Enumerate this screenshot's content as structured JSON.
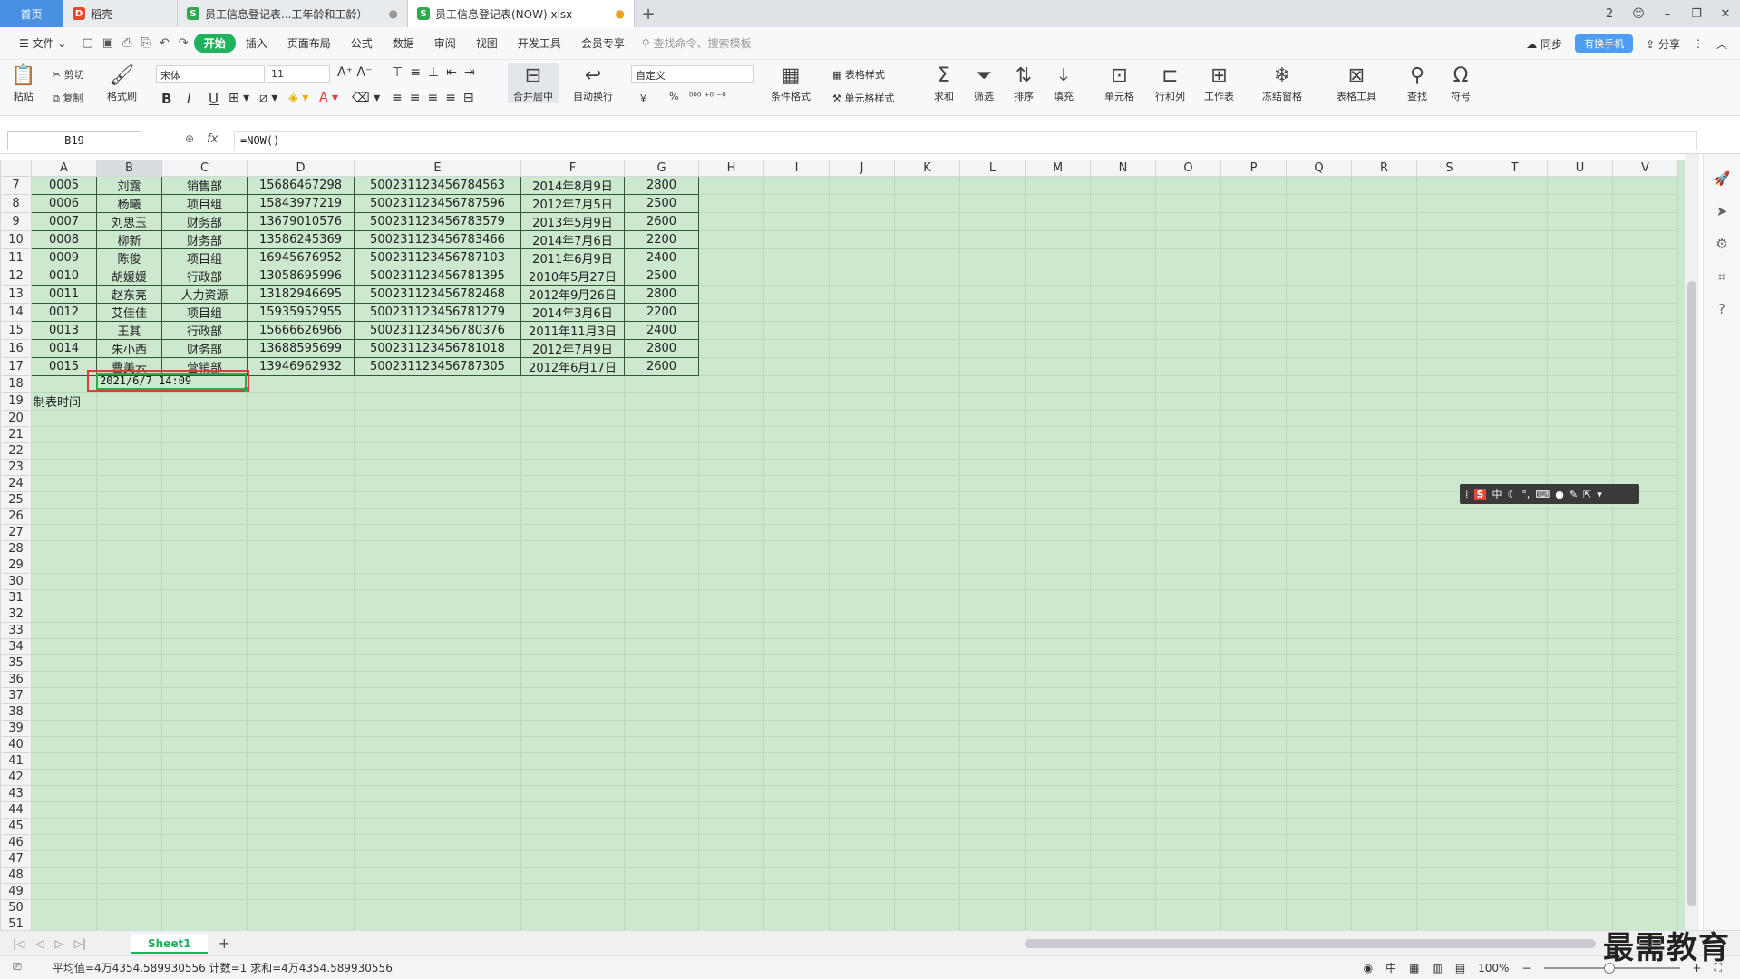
{
  "tabs": [
    {
      "label": "首页"
    },
    {
      "label": "稻壳"
    },
    {
      "label": "员工信息登记表...工年龄和工龄）"
    },
    {
      "label": "员工信息登记表(NOW).xlsx"
    }
  ],
  "window_badge": "2",
  "menu": {
    "file": "文件",
    "items": [
      "开始",
      "插入",
      "页面布局",
      "公式",
      "数据",
      "审阅",
      "视图",
      "开发工具",
      "会员专享"
    ],
    "search_placeholder": "查找命令、搜索模板",
    "sync": "同步",
    "promo": "有换手机",
    "share": "分享"
  },
  "ribbon": {
    "paste": "粘贴",
    "cut": "剪切",
    "copy": "复制",
    "format_painter": "格式刷",
    "font_name": "宋体",
    "font_size": "11",
    "merge_center": "合并居中",
    "wrap": "自动换行",
    "number_format": "自定义",
    "table_style": "表格样式",
    "cond_format": "条件格式",
    "cell_style": "单元格样式",
    "sum": "求和",
    "filter": "筛选",
    "sort": "排序",
    "fill": "填充",
    "cell": "单元格",
    "row_col": "行和列",
    "worksheet": "工作表",
    "freeze": "冻结窗格",
    "table_tools": "表格工具",
    "find": "查找",
    "symbol": "符号",
    "bold": "B",
    "italic": "I",
    "underline": "U",
    "currency": "￥",
    "percent": "%"
  },
  "formula_bar": {
    "name_box": "B19",
    "fx": "fx",
    "formula": "=NOW()"
  },
  "columns": [
    "A",
    "B",
    "C",
    "D",
    "E",
    "F",
    "G",
    "H",
    "I",
    "J",
    "K",
    "L",
    "M",
    "N",
    "O",
    "P",
    "Q",
    "R",
    "S",
    "T",
    "U",
    "V"
  ],
  "rows": [
    {
      "n": "7",
      "cells": [
        "0005",
        "刘露",
        "销售部",
        "15686467298",
        "500231123456784563",
        "2014年8月9日",
        "2800"
      ]
    },
    {
      "n": "8",
      "cells": [
        "0006",
        "杨曦",
        "项目组",
        "15843977219",
        "500231123456787596",
        "2012年7月5日",
        "2500"
      ]
    },
    {
      "n": "9",
      "cells": [
        "0007",
        "刘思玉",
        "财务部",
        "13679010576",
        "500231123456783579",
        "2013年5月9日",
        "2600"
      ]
    },
    {
      "n": "10",
      "cells": [
        "0008",
        "柳新",
        "财务部",
        "13586245369",
        "500231123456783466",
        "2014年7月6日",
        "2200"
      ]
    },
    {
      "n": "11",
      "cells": [
        "0009",
        "陈俊",
        "项目组",
        "16945676952",
        "500231123456787103",
        "2011年6月9日",
        "2400"
      ]
    },
    {
      "n": "12",
      "cells": [
        "0010",
        "胡媛媛",
        "行政部",
        "13058695996",
        "500231123456781395",
        "2010年5月27日",
        "2500"
      ]
    },
    {
      "n": "13",
      "cells": [
        "0011",
        "赵东亮",
        "人力资源",
        "13182946695",
        "500231123456782468",
        "2012年9月26日",
        "2800"
      ]
    },
    {
      "n": "14",
      "cells": [
        "0012",
        "艾佳佳",
        "项目组",
        "15935952955",
        "500231123456781279",
        "2014年3月6日",
        "2200"
      ]
    },
    {
      "n": "15",
      "cells": [
        "0013",
        "王其",
        "行政部",
        "15666626966",
        "500231123456780376",
        "2011年11月3日",
        "2400"
      ]
    },
    {
      "n": "16",
      "cells": [
        "0014",
        "朱小西",
        "财务部",
        "13688595699",
        "500231123456781018",
        "2012年7月9日",
        "2800"
      ]
    },
    {
      "n": "17",
      "cells": [
        "0015",
        "曹美云",
        "营销部",
        "13946962932",
        "500231123456787305",
        "2012年6月17日",
        "2600"
      ]
    }
  ],
  "row19": {
    "label": "制表时间",
    "value": "2021/6/7 14:09"
  },
  "empty_rows": [
    "18",
    "20",
    "21",
    "22",
    "23",
    "24",
    "25",
    "26",
    "27",
    "28",
    "29",
    "30",
    "31",
    "32",
    "33",
    "34",
    "35",
    "36",
    "37",
    "38",
    "39",
    "40",
    "41",
    "42",
    "43",
    "44",
    "45",
    "46",
    "47",
    "48",
    "49",
    "50",
    "51",
    "52"
  ],
  "sheet_tab": "Sheet1",
  "ime": {
    "logo": "S",
    "lang": "中"
  },
  "status": {
    "text": "平均值=4万4354.589930556 计数=1 求和=4万4354.589930556",
    "zoom": "100%",
    "input_mode": "中"
  },
  "watermark": "最需教育"
}
